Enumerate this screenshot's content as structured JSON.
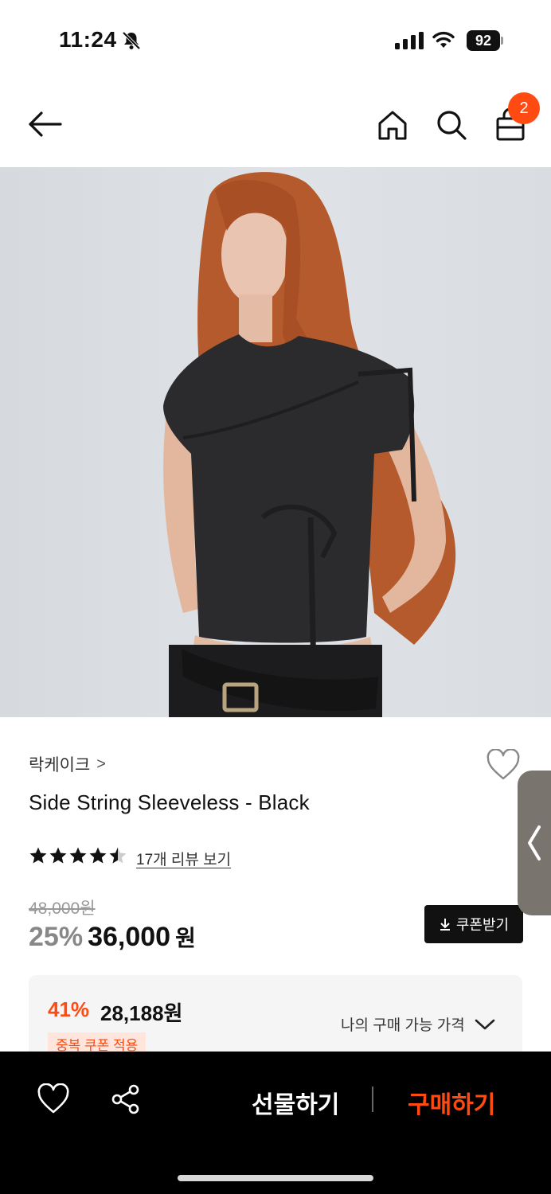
{
  "status_bar": {
    "time": "11:24",
    "battery": "92"
  },
  "nav": {
    "back_icon": "arrow-left-icon",
    "home_icon": "home-icon",
    "search_icon": "search-icon",
    "cart_icon": "shopping-bag-icon",
    "cart_count": "2"
  },
  "product": {
    "image_alt": "model wearing black side string sleeveless top",
    "brand": "락케이크",
    "brand_chevron": ">",
    "title": "Side String Sleeveless - Black",
    "rating": 4.5,
    "review_link": "17개 리뷰 보기",
    "original_price": "48,000원",
    "discount": "25%",
    "price": "36,000",
    "price_unit": "원",
    "coupon_button": "쿠폰받기",
    "my_price": {
      "discount": "41%",
      "price": "28,188원",
      "label": "나의 구매 가능 가격",
      "badge": "중복 쿠폰 적용"
    }
  },
  "bottom_bar": {
    "gift_label": "선물하기",
    "buy_label": "구매하기"
  },
  "colors": {
    "accent": "#ff4a12",
    "dark": "#000000"
  }
}
